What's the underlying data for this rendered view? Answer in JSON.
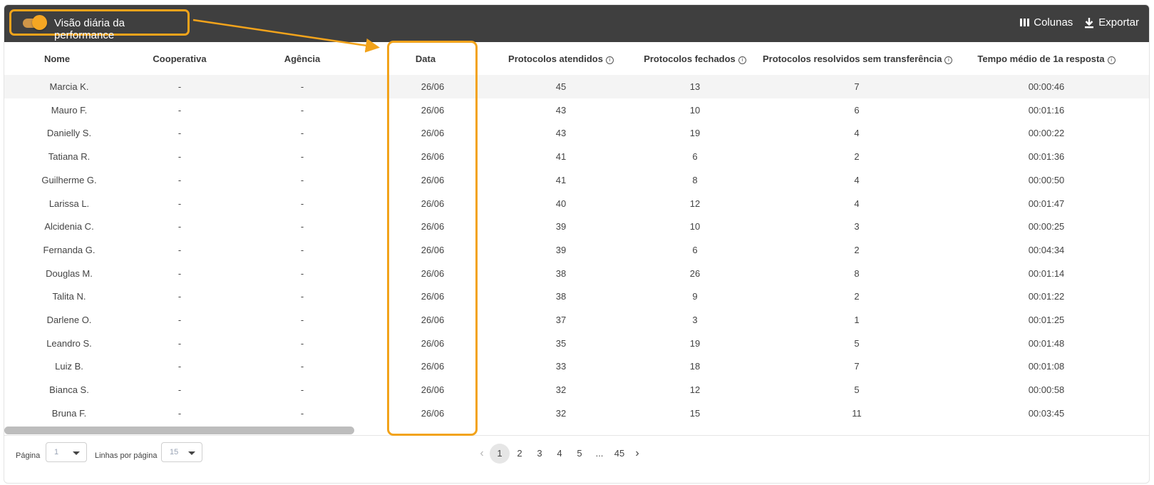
{
  "toolbar": {
    "toggle_label": "Visão diária da performance",
    "toggle_on": true,
    "columns_label": "Colunas",
    "export_label": "Exportar"
  },
  "columns": [
    {
      "key": "nome",
      "label": "Nome",
      "info": false
    },
    {
      "key": "cooperativa",
      "label": "Cooperativa",
      "info": false
    },
    {
      "key": "agencia",
      "label": "Agência",
      "info": false
    },
    {
      "key": "data",
      "label": "Data",
      "info": false
    },
    {
      "key": "atendidos",
      "label": "Protocolos atendidos",
      "info": true
    },
    {
      "key": "fechados",
      "label": "Protocolos fechados",
      "info": true
    },
    {
      "key": "resolvidos",
      "label": "Protocolos resolvidos sem transferência",
      "info": true
    },
    {
      "key": "tempo",
      "label": "Tempo médio de 1a resposta",
      "info": true
    }
  ],
  "rows": [
    [
      "Marcia K.",
      "-",
      "-",
      "26/06",
      "45",
      "13",
      "7",
      "00:00:46"
    ],
    [
      "Mauro F.",
      "-",
      "-",
      "26/06",
      "43",
      "10",
      "6",
      "00:01:16"
    ],
    [
      "Danielly S.",
      "-",
      "-",
      "26/06",
      "43",
      "19",
      "4",
      "00:00:22"
    ],
    [
      "Tatiana R.",
      "-",
      "-",
      "26/06",
      "41",
      "6",
      "2",
      "00:01:36"
    ],
    [
      "Guilherme G.",
      "-",
      "-",
      "26/06",
      "41",
      "8",
      "4",
      "00:00:50"
    ],
    [
      "Larissa L.",
      "-",
      "-",
      "26/06",
      "40",
      "12",
      "4",
      "00:01:47"
    ],
    [
      "Alcidenia C.",
      "-",
      "-",
      "26/06",
      "39",
      "10",
      "3",
      "00:00:25"
    ],
    [
      "Fernanda G.",
      "-",
      "-",
      "26/06",
      "39",
      "6",
      "2",
      "00:04:34"
    ],
    [
      "Douglas M.",
      "-",
      "-",
      "26/06",
      "38",
      "26",
      "8",
      "00:01:14"
    ],
    [
      "Talita N.",
      "-",
      "-",
      "26/06",
      "38",
      "9",
      "2",
      "00:01:22"
    ],
    [
      "Darlene O.",
      "-",
      "-",
      "26/06",
      "37",
      "3",
      "1",
      "00:01:25"
    ],
    [
      "Leandro S.",
      "-",
      "-",
      "26/06",
      "35",
      "19",
      "5",
      "00:01:48"
    ],
    [
      "Luiz B.",
      "-",
      "-",
      "26/06",
      "33",
      "18",
      "7",
      "00:01:08"
    ],
    [
      "Bianca S.",
      "-",
      "-",
      "26/06",
      "32",
      "12",
      "5",
      "00:00:58"
    ],
    [
      "Bruna F.",
      "-",
      "-",
      "26/06",
      "32",
      "15",
      "11",
      "00:03:45"
    ]
  ],
  "footer": {
    "page_label": "Página",
    "page_value": "1",
    "rows_label": "Linhas por página",
    "rows_value": "15",
    "pages": [
      "1",
      "2",
      "3",
      "4",
      "5",
      "...",
      "45"
    ],
    "current_page": "1"
  },
  "colors": {
    "toolbar_bg": "#3f3f3f",
    "accent": "#f2a31b",
    "row_highlight": "#f4f4f4"
  },
  "icons": {
    "columns": "columns-icon",
    "export": "download-icon",
    "info": "info-circle-icon",
    "prev": "chevron-left-icon",
    "next": "chevron-right-icon",
    "dropdown": "caret-down-icon"
  }
}
